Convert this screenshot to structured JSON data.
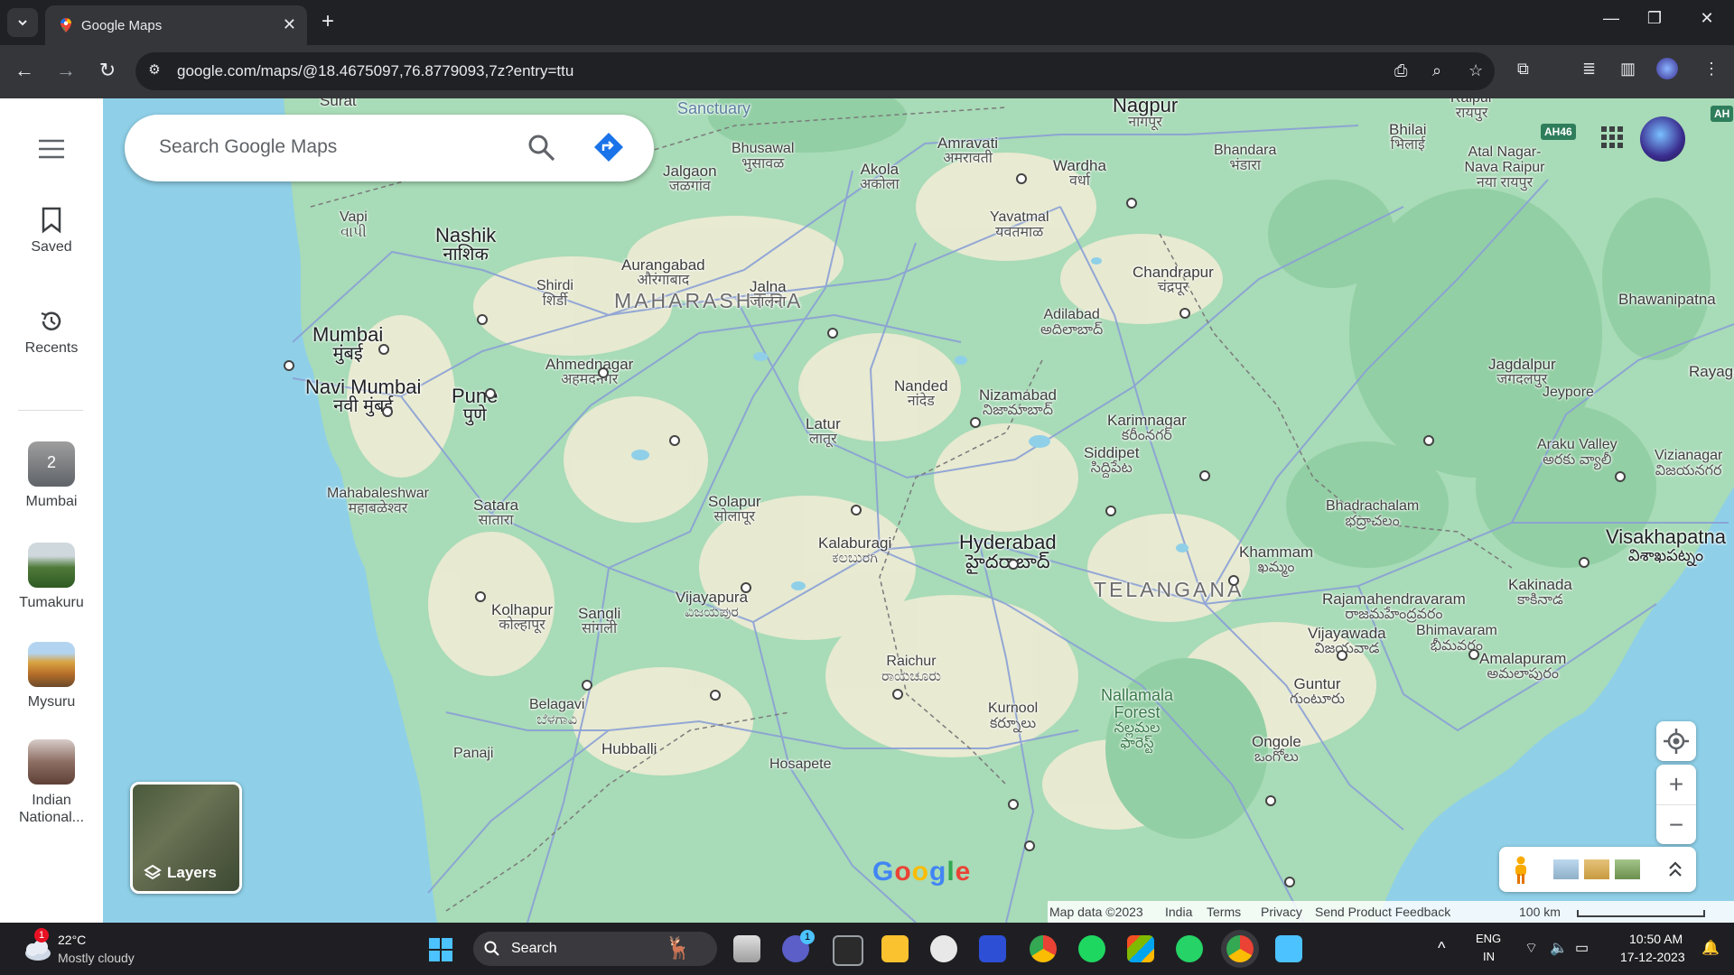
{
  "browser": {
    "tab_title": "Google Maps",
    "new_tab": "+",
    "url": "google.com/maps/@18.4675097,76.8779093,7z?entry=ttu"
  },
  "rail": {
    "menu_icon": "menu-icon",
    "saved": "Saved",
    "recents": "Recents",
    "recent_places": [
      {
        "label": "Mumbai",
        "badge": "2"
      },
      {
        "label": "Tumakuru"
      },
      {
        "label": "Mysuru"
      },
      {
        "label": "Indian National..."
      }
    ]
  },
  "search": {
    "placeholder": "Search Google Maps"
  },
  "map": {
    "state_labels": [
      "MAHARASHTRA",
      "TELANGANA"
    ],
    "places": [
      {
        "id": "surat",
        "name": "Surat",
        "local": ""
      },
      {
        "id": "sanctuary",
        "name": "Sanctuary",
        "local": ""
      },
      {
        "id": "bhusawal",
        "name": "Bhusawal",
        "local": "भुसावळ"
      },
      {
        "id": "jalgaon",
        "name": "Jalgaon",
        "local": "जळगांव"
      },
      {
        "id": "amravati",
        "name": "Amravati",
        "local": "अमरावती"
      },
      {
        "id": "akola",
        "name": "Akola",
        "local": "अकोला"
      },
      {
        "id": "nagpur",
        "name": "Nagpur",
        "local": "नागपूर"
      },
      {
        "id": "bhandara",
        "name": "Bhandara",
        "local": "भंडारा"
      },
      {
        "id": "wardha",
        "name": "Wardha",
        "local": "वर्धा"
      },
      {
        "id": "bhilai",
        "name": "Bhilai",
        "local": "भिलाई"
      },
      {
        "id": "raipur",
        "name": "Raipur",
        "local": "रायपुर"
      },
      {
        "id": "atal",
        "name": "Atal Nagar-Nava Raipur",
        "local": "नया रायपुर"
      },
      {
        "id": "vapi",
        "name": "Vapi",
        "local": "વાપી"
      },
      {
        "id": "nashik",
        "name": "Nashik",
        "local": "नाशिक"
      },
      {
        "id": "shirdi",
        "name": "Shirdi",
        "local": "शिर्डी"
      },
      {
        "id": "aurangabad",
        "name": "Aurangabad",
        "local": "औरंगाबाद"
      },
      {
        "id": "jalna",
        "name": "Jalna",
        "local": "जालना"
      },
      {
        "id": "yavatmal",
        "name": "Yavatmal",
        "local": "यवतमाळ"
      },
      {
        "id": "chandrapur",
        "name": "Chandrapur",
        "local": "चंद्रपूर"
      },
      {
        "id": "adilabad",
        "name": "Adilabad",
        "local": "అదిలాబాద్"
      },
      {
        "id": "bhawanipatna",
        "name": "Bhawanipatna",
        "local": ""
      },
      {
        "id": "mumbai",
        "name": "Mumbai",
        "local": "मुंबई"
      },
      {
        "id": "ahmednagar",
        "name": "Ahmednagar",
        "local": "अहमदनगर"
      },
      {
        "id": "nanded",
        "name": "Nanded",
        "local": "नांदेड"
      },
      {
        "id": "jagdalpur",
        "name": "Jagdalpur",
        "local": "जगदलपुर"
      },
      {
        "id": "rayagada",
        "name": "Rayagad",
        "local": ""
      },
      {
        "id": "navimumbai",
        "name": "Navi Mumbai",
        "local": "नवी मुंबई"
      },
      {
        "id": "pune",
        "name": "Pune",
        "local": "पुणे"
      },
      {
        "id": "nizamabad",
        "name": "Nizamabad",
        "local": "నిజామాబాద్"
      },
      {
        "id": "karimnagar",
        "name": "Karimnagar",
        "local": "కరీంనగర్"
      },
      {
        "id": "jeypore",
        "name": "Jeypore",
        "local": ""
      },
      {
        "id": "latur",
        "name": "Latur",
        "local": "लातूर"
      },
      {
        "id": "siddipet",
        "name": "Siddipet",
        "local": "సిద్దిపేట"
      },
      {
        "id": "arakuvalley",
        "name": "Araku Valley",
        "local": "అరకు వ్యాలీ"
      },
      {
        "id": "vizianagaram",
        "name": "Vizianagar",
        "local": "విజయనగర"
      },
      {
        "id": "mahabaleshwar",
        "name": "Mahabaleshwar",
        "local": "महाबळेश्वर"
      },
      {
        "id": "satara",
        "name": "Satara",
        "local": "सातारा"
      },
      {
        "id": "solapur",
        "name": "Solapur",
        "local": "सोलापूर"
      },
      {
        "id": "bhadrachalam",
        "name": "Bhadrachalam",
        "local": "భద్రాచలం"
      },
      {
        "id": "visakhapatnam",
        "name": "Visakhapatna",
        "local": "విశాఖపట్నం"
      },
      {
        "id": "kalaburagi",
        "name": "Kalaburagi",
        "local": "ಕಲಬುರಗಿ"
      },
      {
        "id": "hyderabad",
        "name": "Hyderabad",
        "local": "హైదరాబాద్"
      },
      {
        "id": "khammam",
        "name": "Khammam",
        "local": "ఖమ్మం"
      },
      {
        "id": "kakinada",
        "name": "Kakinada",
        "local": "కాకినాడ"
      },
      {
        "id": "vijayapura",
        "name": "Vijayapura",
        "local": "ವಿಜಯಪುರ"
      },
      {
        "id": "kolhapur",
        "name": "Kolhapur",
        "local": "कोल्हापूर"
      },
      {
        "id": "sangli",
        "name": "Sangli",
        "local": "सांगली"
      },
      {
        "id": "rajamahendravaram",
        "name": "Rajamahendravaram",
        "local": "రాజమహేంద్రవరం"
      },
      {
        "id": "vijayawada",
        "name": "Vijayawada",
        "local": "విజయవాడ"
      },
      {
        "id": "bhimavaram",
        "name": "Bhimavaram",
        "local": "భీమవరం"
      },
      {
        "id": "amalapuram",
        "name": "Amalapuram",
        "local": "అమలాపురం"
      },
      {
        "id": "raichur",
        "name": "Raichur",
        "local": "ರಾಯಚೂರು"
      },
      {
        "id": "guntur",
        "name": "Guntur",
        "local": "గుంటూరు"
      },
      {
        "id": "belagavi",
        "name": "Belagavi",
        "local": "ಬೆಳಗಾವಿ"
      },
      {
        "id": "kurnool",
        "name": "Kurnool",
        "local": "కర్నూలు"
      },
      {
        "id": "nallamala",
        "name": "Nallamala Forest",
        "local": "నల్లమల ఫారెస్ట్"
      },
      {
        "id": "ongole",
        "name": "Ongole",
        "local": "ఒంగోలు"
      },
      {
        "id": "hubballi",
        "name": "Hubballi",
        "local": ""
      },
      {
        "id": "panaji",
        "name": "Panaji",
        "local": ""
      },
      {
        "id": "hosapete",
        "name": "Hosapete",
        "local": ""
      }
    ],
    "highway_badges": [
      "AH46",
      "AH"
    ],
    "layers_label": "Layers",
    "google_logo": "Google",
    "footer": {
      "map_data": "Map data ©2023",
      "india": "India",
      "terms": "Terms",
      "privacy": "Privacy",
      "feedback": "Send Product Feedback",
      "scale": "100 km"
    },
    "colors": {
      "land": "#a8dbb7",
      "water": "#8fd0e8",
      "tan": "#f3ecd6",
      "forest": "#92cfa4",
      "road": "#8aa0d6",
      "directions": "#1a73e8"
    }
  },
  "taskbar": {
    "weather_temp": "22°C",
    "weather_desc": "Mostly cloudy",
    "weather_badge": "1",
    "search_label": "Search",
    "teams_badge": "1",
    "lang_top": "ENG",
    "lang_bottom": "IN",
    "time": "10:50 AM",
    "date": "17-12-2023"
  }
}
